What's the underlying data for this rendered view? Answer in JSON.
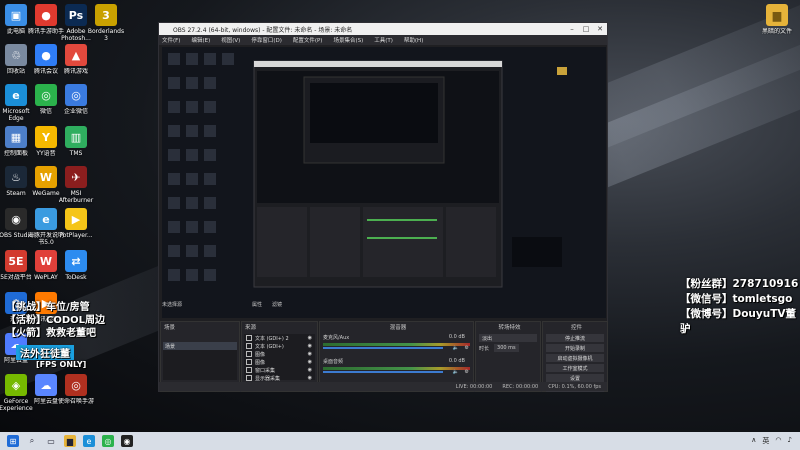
{
  "desktop_icons": [
    {
      "label": "此电脑",
      "color": "#3a8ee6",
      "glyph": "▣",
      "col": 0,
      "row": 0
    },
    {
      "label": "腾讯手游助手",
      "color": "#e03a2f",
      "glyph": "●",
      "col": 1,
      "row": 0
    },
    {
      "label": "Adobe Photosh...",
      "color": "#0b2a52",
      "glyph": "Ps",
      "col": 2,
      "row": 0
    },
    {
      "label": "Borderlands 3",
      "color": "#c9a100",
      "glyph": "3",
      "col": 3,
      "row": 0
    },
    {
      "label": "回收站",
      "color": "#7a8aa0",
      "glyph": "♲",
      "col": 0,
      "row": 1
    },
    {
      "label": "腾讯会议",
      "color": "#2f7df6",
      "glyph": "●",
      "col": 1,
      "row": 1
    },
    {
      "label": "腾讯游戏",
      "color": "#e2493d",
      "glyph": "▲",
      "col": 2,
      "row": 1
    },
    {
      "label": "Microsoft Edge",
      "color": "#1b8fd8",
      "glyph": "e",
      "col": 0,
      "row": 2
    },
    {
      "label": "微信",
      "color": "#2bb24c",
      "glyph": "◎",
      "col": 1,
      "row": 2
    },
    {
      "label": "企业微信",
      "color": "#3a7be0",
      "glyph": "◎",
      "col": 2,
      "row": 2
    },
    {
      "label": "控制面板",
      "color": "#4d7fc9",
      "glyph": "▦",
      "col": 0,
      "row": 3
    },
    {
      "label": "YY语音",
      "color": "#f5b800",
      "glyph": "Y",
      "col": 1,
      "row": 3
    },
    {
      "label": "TMS",
      "color": "#2fae5f",
      "glyph": "▥",
      "col": 2,
      "row": 3
    },
    {
      "label": "Steam",
      "color": "#1b2838",
      "glyph": "♨",
      "col": 0,
      "row": 4
    },
    {
      "label": "WeGame",
      "color": "#e6a100",
      "glyph": "W",
      "col": 1,
      "row": 4
    },
    {
      "label": "MSI Afterburner",
      "color": "#8b1e1e",
      "glyph": "✈",
      "col": 2,
      "row": 4
    },
    {
      "label": "OBS Studio",
      "color": "#2a2a2a",
      "glyph": "◉",
      "col": 0,
      "row": 5
    },
    {
      "label": "海豚开发说明书5.0",
      "color": "#3a9be0",
      "glyph": "e",
      "col": 1,
      "row": 5
    },
    {
      "label": "PotPlayer...",
      "color": "#f5c518",
      "glyph": "▶",
      "col": 2,
      "row": 5
    },
    {
      "label": "5E对战平台",
      "color": "#d23b2f",
      "glyph": "5E",
      "col": 0,
      "row": 6
    },
    {
      "label": "WePLAY",
      "color": "#e0403a",
      "glyph": "W",
      "col": 1,
      "row": 6
    },
    {
      "label": "ToDesk",
      "color": "#2d8cf0",
      "glyph": "⇄",
      "col": 2,
      "row": 6
    },
    {
      "label": "开始",
      "color": "#1f6bd6",
      "glyph": "⚙",
      "col": 0,
      "row": 7
    },
    {
      "label": "腾讯视频",
      "color": "#ff7a00",
      "glyph": "▶",
      "col": 1,
      "row": 7
    },
    {
      "label": "阿里云盘",
      "color": "#4f7cff",
      "glyph": "☁",
      "col": 0,
      "row": 8
    },
    {
      "label": "GeForce Experience",
      "color": "#76b900",
      "glyph": "◈",
      "col": 0,
      "row": 9
    },
    {
      "label": "阿里云盘",
      "color": "#5a86ff",
      "glyph": "☁",
      "col": 1,
      "row": 9
    },
    {
      "label": "使命召唤手游",
      "color": "#b03020",
      "glyph": "◎",
      "col": 2,
      "row": 9
    }
  ],
  "right_icon": {
    "label": "黑暗的文件",
    "color": "#e6b33a",
    "glyph": "▆"
  },
  "obs": {
    "title": "OBS 27.2.4 (64-bit, windows) - 配置文件: 未命名 - 场景: 未命名",
    "menus": [
      "文件(F)",
      "编辑(E)",
      "视图(V)",
      "停靠窗口(D)",
      "配置文件(P)",
      "场景集合(S)",
      "工具(T)",
      "帮助(H)"
    ],
    "scenes_panel_title": "场景",
    "scene_item": "场景",
    "sources_panel_title": "来源",
    "sources": [
      {
        "name": "文本 (GDI+) 2"
      },
      {
        "name": "文本 (GDI+)"
      },
      {
        "name": "图像"
      },
      {
        "name": "图像"
      },
      {
        "name": "窗口采集"
      },
      {
        "name": "显示器采集"
      }
    ],
    "mixer_title": "混音器",
    "mixer_tracks": [
      {
        "name": "麦克风/Aux",
        "db": "0.0 dB"
      },
      {
        "name": "桌面音频",
        "db": "0.0 dB"
      }
    ],
    "transitions_title": "转场特效",
    "transition_value": "淡出",
    "duration_label": "时长",
    "duration_value": "300 ms",
    "controls_title": "控件",
    "controls": [
      "停止推流",
      "开始录制",
      "启动虚拟摄像机",
      "工作室模式",
      "设置",
      "退出"
    ],
    "status": {
      "live": "LIVE: 00:00:00",
      "rec": "REC: 00:00:00",
      "cpu": "CPU: 0.1%, 60.00 fps"
    },
    "no_source_selected": "未选择源",
    "filters": "滤镜",
    "properties": "属性"
  },
  "overlay": {
    "fans": "【粉丝群】278710916",
    "wechat": "【微信号】tomletsgo",
    "weibo": "【微博号】DouyuTV董驴",
    "left1": "【挑战】车位/房管",
    "left2": "【活粉】CODOL周边",
    "left3": "【火箭】救救老董吧",
    "left4": "法外狂徒董",
    "left5": "[FPS ONLY]"
  },
  "taskbar": {
    "right_text": "英"
  }
}
